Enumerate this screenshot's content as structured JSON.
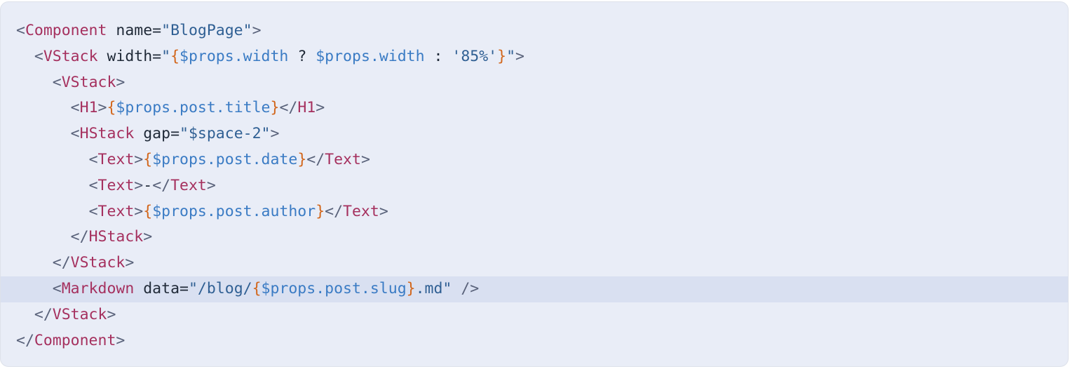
{
  "colors": {
    "background": "#e9edf7",
    "highlight_line": "#d9e0f1",
    "tag": "#a5305e",
    "string": "#2f5f93",
    "brace": "#d2661b",
    "expression": "#3a7bc4",
    "punctuation": "#59627a"
  },
  "code": {
    "language": "xmlui",
    "highlighted_line_index": 10,
    "lines": [
      {
        "indent": "",
        "tokens": [
          {
            "t": "punct",
            "v": "<"
          },
          {
            "t": "tag",
            "v": "Component"
          },
          {
            "t": "attr",
            "v": " name="
          },
          {
            "t": "str",
            "v": "\"BlogPage\""
          },
          {
            "t": "punct",
            "v": ">"
          }
        ]
      },
      {
        "indent": "  ",
        "tokens": [
          {
            "t": "punct",
            "v": "<"
          },
          {
            "t": "tag",
            "v": "VStack"
          },
          {
            "t": "attr",
            "v": " width="
          },
          {
            "t": "str",
            "v": "\""
          },
          {
            "t": "brace",
            "v": "{"
          },
          {
            "t": "expr",
            "v": "$props.width"
          },
          {
            "t": "plain",
            "v": " ? "
          },
          {
            "t": "expr",
            "v": "$props.width"
          },
          {
            "t": "plain",
            "v": " : "
          },
          {
            "t": "str",
            "v": "'85%'"
          },
          {
            "t": "brace",
            "v": "}"
          },
          {
            "t": "str",
            "v": "\""
          },
          {
            "t": "punct",
            "v": ">"
          }
        ]
      },
      {
        "indent": "    ",
        "tokens": [
          {
            "t": "punct",
            "v": "<"
          },
          {
            "t": "tag",
            "v": "VStack"
          },
          {
            "t": "punct",
            "v": ">"
          }
        ]
      },
      {
        "indent": "      ",
        "tokens": [
          {
            "t": "punct",
            "v": "<"
          },
          {
            "t": "tag",
            "v": "H1"
          },
          {
            "t": "punct",
            "v": ">"
          },
          {
            "t": "brace",
            "v": "{"
          },
          {
            "t": "expr",
            "v": "$props.post.title"
          },
          {
            "t": "brace",
            "v": "}"
          },
          {
            "t": "punct",
            "v": "</"
          },
          {
            "t": "tag",
            "v": "H1"
          },
          {
            "t": "punct",
            "v": ">"
          }
        ]
      },
      {
        "indent": "      ",
        "tokens": [
          {
            "t": "punct",
            "v": "<"
          },
          {
            "t": "tag",
            "v": "HStack"
          },
          {
            "t": "attr",
            "v": " gap="
          },
          {
            "t": "str",
            "v": "\"$space-2\""
          },
          {
            "t": "punct",
            "v": ">"
          }
        ]
      },
      {
        "indent": "        ",
        "tokens": [
          {
            "t": "punct",
            "v": "<"
          },
          {
            "t": "tag",
            "v": "Text"
          },
          {
            "t": "punct",
            "v": ">"
          },
          {
            "t": "brace",
            "v": "{"
          },
          {
            "t": "expr",
            "v": "$props.post.date"
          },
          {
            "t": "brace",
            "v": "}"
          },
          {
            "t": "punct",
            "v": "</"
          },
          {
            "t": "tag",
            "v": "Text"
          },
          {
            "t": "punct",
            "v": ">"
          }
        ]
      },
      {
        "indent": "        ",
        "tokens": [
          {
            "t": "punct",
            "v": "<"
          },
          {
            "t": "tag",
            "v": "Text"
          },
          {
            "t": "punct",
            "v": ">"
          },
          {
            "t": "plain",
            "v": "-"
          },
          {
            "t": "punct",
            "v": "</"
          },
          {
            "t": "tag",
            "v": "Text"
          },
          {
            "t": "punct",
            "v": ">"
          }
        ]
      },
      {
        "indent": "        ",
        "tokens": [
          {
            "t": "punct",
            "v": "<"
          },
          {
            "t": "tag",
            "v": "Text"
          },
          {
            "t": "punct",
            "v": ">"
          },
          {
            "t": "brace",
            "v": "{"
          },
          {
            "t": "expr",
            "v": "$props.post.author"
          },
          {
            "t": "brace",
            "v": "}"
          },
          {
            "t": "punct",
            "v": "</"
          },
          {
            "t": "tag",
            "v": "Text"
          },
          {
            "t": "punct",
            "v": ">"
          }
        ]
      },
      {
        "indent": "      ",
        "tokens": [
          {
            "t": "punct",
            "v": "</"
          },
          {
            "t": "tag",
            "v": "HStack"
          },
          {
            "t": "punct",
            "v": ">"
          }
        ]
      },
      {
        "indent": "    ",
        "tokens": [
          {
            "t": "punct",
            "v": "</"
          },
          {
            "t": "tag",
            "v": "VStack"
          },
          {
            "t": "punct",
            "v": ">"
          }
        ]
      },
      {
        "indent": "    ",
        "tokens": [
          {
            "t": "punct",
            "v": "<"
          },
          {
            "t": "tag",
            "v": "Markdown"
          },
          {
            "t": "attr",
            "v": " data="
          },
          {
            "t": "str",
            "v": "\"/blog/"
          },
          {
            "t": "brace",
            "v": "{"
          },
          {
            "t": "expr",
            "v": "$props.post.slug"
          },
          {
            "t": "brace",
            "v": "}"
          },
          {
            "t": "str",
            "v": ".md\""
          },
          {
            "t": "punct",
            "v": " />"
          }
        ]
      },
      {
        "indent": "  ",
        "tokens": [
          {
            "t": "punct",
            "v": "</"
          },
          {
            "t": "tag",
            "v": "VStack"
          },
          {
            "t": "punct",
            "v": ">"
          }
        ]
      },
      {
        "indent": "",
        "tokens": [
          {
            "t": "punct",
            "v": "</"
          },
          {
            "t": "tag",
            "v": "Component"
          },
          {
            "t": "punct",
            "v": ">"
          }
        ]
      }
    ]
  }
}
